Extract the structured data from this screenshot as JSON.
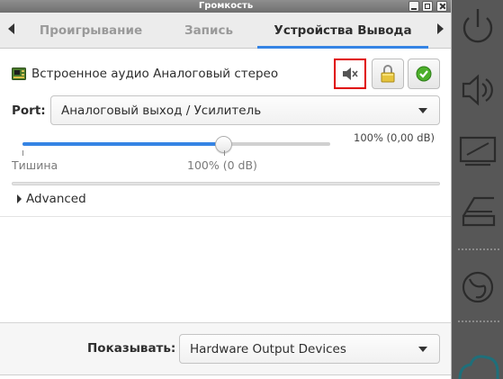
{
  "window": {
    "title": "Громкость"
  },
  "tabs": [
    {
      "label": "Проигрывание",
      "active": false
    },
    {
      "label": "Запись",
      "active": false
    },
    {
      "label": "Устройства Вывода",
      "active": true
    }
  ],
  "device": {
    "name": "Встроенное аудио Аналоговый стерео",
    "icon": "sound-card-icon",
    "buttons": [
      {
        "name": "mute",
        "icon": "speaker-muted-icon"
      },
      {
        "name": "lock-channels",
        "icon": "padlock-icon"
      },
      {
        "name": "set-default",
        "icon": "checkmark-icon"
      }
    ]
  },
  "port": {
    "label": "Port:",
    "value": "Аналоговый выход / Усилитель"
  },
  "volume": {
    "peak_label": "100% (0,00 dB)",
    "min_label": "Тишина",
    "mid_label": "100% (0 dB)",
    "level_percent": 100,
    "scale_max_percent": 153
  },
  "advanced": {
    "label": "Advanced",
    "expanded": false
  },
  "show": {
    "label": "Показывать:",
    "value": "Hardware Output Devices"
  },
  "dock": {
    "items": [
      "power-icon",
      "speaker-volume-icon",
      "display-icon",
      "scanner-icon",
      "firefox-icon",
      "cloud-icon"
    ]
  },
  "colors": {
    "accent": "#3584e4",
    "highlight": "#e00000",
    "dock_bg": "#575757"
  }
}
